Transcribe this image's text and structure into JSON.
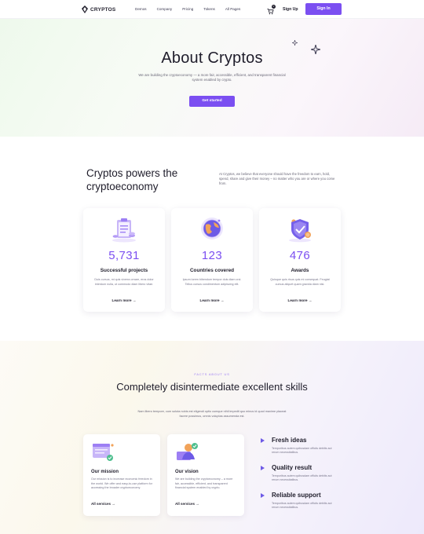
{
  "nav": {
    "brand": "CRYPTOS",
    "links": [
      "Demos",
      "Company",
      "Pricing",
      "Tokens",
      "All Pages"
    ],
    "cart_count": "0",
    "sign_up": "Sign Up",
    "sign_in": "Sign In"
  },
  "hero": {
    "title": "About Cryptos",
    "text": "We are building the cryptoeconomy — a more fair, accessible, efficient, and transparent financial system enabled by crypto.",
    "cta": "Get started"
  },
  "powers": {
    "title": "Cryptos powers the cryptoeconomy",
    "text": "At Cryptos, we believe that everyone should have the freedom to earn, hold, spend, share and give their money – no matter who you are or where you come from."
  },
  "stats": [
    {
      "icon": "clipboard-coins-icon",
      "value": "5,731",
      "label": "Successful projects",
      "text": "Duis cursus, mi quis viverra ornare, eros dolor interdum nulla, ut commodo diam libero vitae.",
      "more": "Learn more"
    },
    {
      "icon": "globe-icon",
      "value": "123",
      "label": "Countries covered",
      "text": "Ipsum lorem bibendum tempor duis diam orci. Tellus cursus condimentum adipiscing elit.",
      "more": "Learn more"
    },
    {
      "icon": "shield-coin-icon",
      "value": "476",
      "label": "Awards",
      "text": "Quisque quis risus quis mi consequat. Feugiat cursus aliquet quam gravida diam nisi.",
      "more": "Learn more"
    }
  ],
  "facts": {
    "eyebrow": "FACTS ABOUT US",
    "title": "Completely disintermediate excellent skills",
    "text": "Nam libero tempore, cum soluta nobis est eligendi optio cumque nihil impedit quo minus id quod maxime placeat facere possimus, omnis voluptas assumenda est.",
    "cards": [
      {
        "icon": "mission-icon",
        "title": "Our mission",
        "text": "Our mission is to increase economic freedom in the world. We offer and easy-to-use platform for accessing the broader cryptoeconomy.",
        "more": "All services"
      },
      {
        "icon": "vision-icon",
        "title": "Our vision",
        "text": "We are building the cryptoeconomy – a more fair, accessible, efficient, and transparent financial system enabled by crypto.",
        "more": "All services"
      }
    ],
    "features": [
      {
        "title": "Fresh ideas",
        "text": "Temporibus autem quibusdam officiis debitis aut rerum necessitatibus."
      },
      {
        "title": "Quality result",
        "text": "Temporibus autem quibusdam officiis debitis aut rerum necessitatibus."
      },
      {
        "title": "Reliable support",
        "text": "Temporibus autem quibusdam officiis debitis aut rerum necessitatibus."
      }
    ]
  },
  "colors": {
    "accent": "#7b4ff1",
    "text": "#1f1d2b",
    "muted": "#6a6878"
  }
}
